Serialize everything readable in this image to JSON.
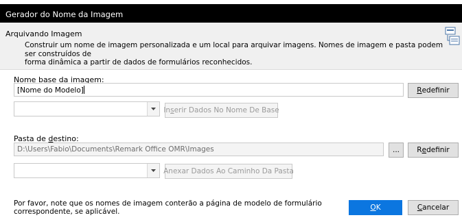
{
  "window": {
    "title": "Gerador do Nome da Imagem"
  },
  "header": {
    "title": "Arquivando Imagem",
    "description_line1": "Construir um nome de imagem personalizada e um local para arquivar imagens. Nomes de imagem e pasta podem ser construídos de",
    "description_line2": "forma dinâmica a partir de dados de formulários reconhecidos."
  },
  "base_name": {
    "label_pre": "Nome ",
    "label_accel": "b",
    "label_post": "ase da imagem:",
    "value": "[Nome do Modelo]",
    "reset_accel": "R",
    "reset_rest": "edefinir",
    "combo_value": "",
    "insert_pre": "In",
    "insert_accel": "s",
    "insert_post": "erir Dados No Nome De Base"
  },
  "dest_folder": {
    "label_pre": "Pasta de ",
    "label_accel": "d",
    "label_post": "estino:",
    "value": "D:\\Users\\Fabio\\Documents\\Remark Office OMR\\Images",
    "browse_label": "...",
    "reset_pre": "R",
    "reset_accel": "e",
    "reset_post": "definir",
    "combo_value": "",
    "append_label": "Anexar Dados Ao Caminho Da Pasta"
  },
  "footer": {
    "note": "Por favor, note que os nomes de imagem conterão a página de modelo de formulário correspondente, se aplicável.",
    "ok_accel": "O",
    "ok_rest": "K",
    "cancel_accel": "C",
    "cancel_rest": "ancelar"
  },
  "colors": {
    "primary": "#0b76e0",
    "titlebar": "#000000",
    "header_bg": "#f0f0f0"
  }
}
